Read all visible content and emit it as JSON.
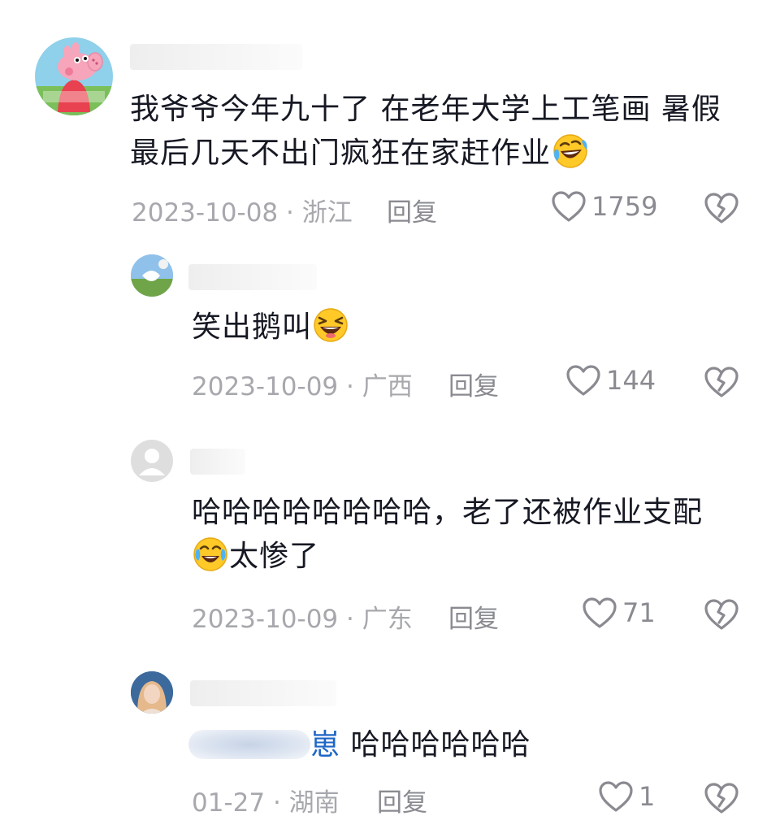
{
  "comments": [
    {
      "text": "我爷爷今年九十了 在老年大学上工笔画 暑假最后几天不出门疯狂在家赶作业",
      "date": "2023-10-08",
      "location": "浙江",
      "reply_label": "回复",
      "likes": "1759",
      "emoji": "laugh-cry-tilted-emoji",
      "avatar": "peppa-pig-avatar"
    },
    {
      "text": "笑出鹅叫",
      "date": "2023-10-09",
      "location": "广西",
      "reply_label": "回复",
      "likes": "144",
      "emoji": "laughing-emoji",
      "avatar": "landscape-avatar"
    },
    {
      "text_line1": "哈哈哈哈哈哈哈哈，老了还被作业支配",
      "text_line2": "太惨了",
      "date": "2023-10-09",
      "location": "广东",
      "reply_label": "回复",
      "likes": "71",
      "emoji": "laugh-cry-emoji",
      "avatar": "default-user-avatar"
    },
    {
      "mention_tail": "崽",
      "text": "哈哈哈哈哈哈",
      "date": "01-27",
      "location": "湖南",
      "reply_label": "回复",
      "likes": "1",
      "avatar": "girl-photo-avatar"
    }
  ],
  "separator": "·",
  "colors": {
    "text": "#161823",
    "meta": "#a7a8ad",
    "mention": "#1e66c7",
    "icon": "#8a8b91"
  }
}
